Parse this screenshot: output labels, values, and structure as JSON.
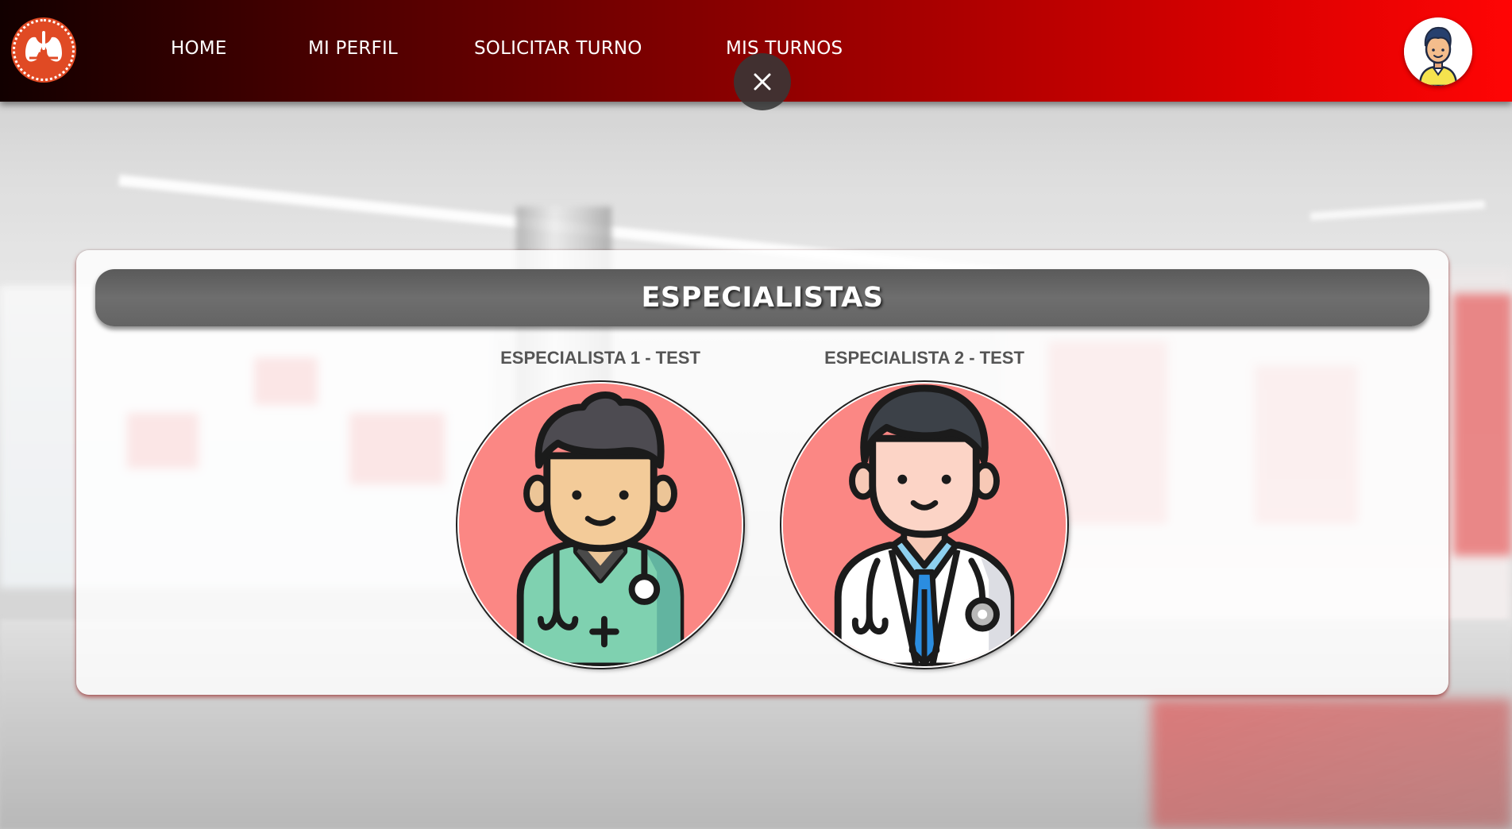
{
  "nav": {
    "logo_icon": "lungs-heartbeat-logo-icon",
    "links": [
      {
        "label": "HOME"
      },
      {
        "label": "MI PERFIL"
      },
      {
        "label": "SOLICITAR TURNO"
      },
      {
        "label": "MIS TURNOS"
      }
    ],
    "close_icon": "close-icon",
    "user_avatar_icon": "user-avatar-icon"
  },
  "card": {
    "title": "ESPECIALISTAS",
    "specialists": [
      {
        "name": "ESPECIALISTA 1 - TEST",
        "avatar": "nurse-doctor-avatar"
      },
      {
        "name": "ESPECIALISTA 2 - TEST",
        "avatar": "doctor-coat-avatar"
      }
    ]
  },
  "colors": {
    "navbar_start": "#120000",
    "navbar_end": "#ff0505",
    "header_bar": "#666666",
    "avatar_bg": "#fb8784",
    "specialist_name": "#555555"
  }
}
